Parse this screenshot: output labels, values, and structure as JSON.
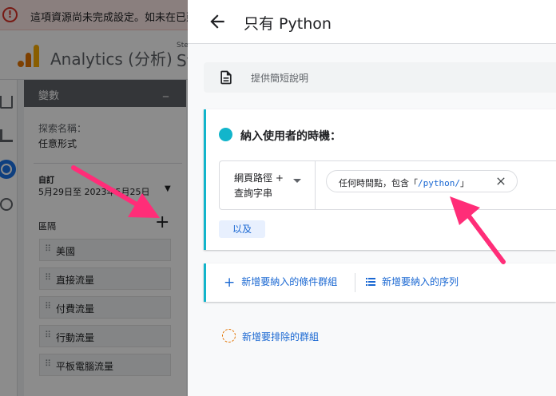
{
  "warning": {
    "text": "這項資源尚未完成設定。如未在已建"
  },
  "app": {
    "name": "Analytics (分析)",
    "property_label": "Ste",
    "property_name": "St"
  },
  "variables_panel": {
    "title": "變數",
    "minimize_glyph": "_",
    "exploration_name_label": "探索名稱：",
    "exploration_name_value": "任意形式",
    "date_label": "自訂",
    "date_range": "5月29日至 2023年5月25日",
    "segments_label": "區隔",
    "add_glyph": "+",
    "segments": [
      "美國",
      "直接流量",
      "付費流量",
      "行動流量",
      "平板電腦流量"
    ]
  },
  "drawer": {
    "title": "只有 Python",
    "description_placeholder": "提供簡短說明",
    "include_title": "納入使用者的時機：",
    "condition": {
      "dimension_line1": "網頁路徑 +",
      "dimension_line2": "查詢字串",
      "filter_prefix": "任何時間點，包含「",
      "filter_value": "/python/",
      "filter_suffix": "」"
    },
    "and_label": "以及",
    "add_condition_group": "新增要納入的條件群組",
    "add_sequence": "新增要納入的序列",
    "add_exclude_group": "新增要排除的群組"
  },
  "colors": {
    "accent": "#1967d2",
    "include": "#12b5cb",
    "annotation": "#ff2d78",
    "warning": "#d93025"
  }
}
